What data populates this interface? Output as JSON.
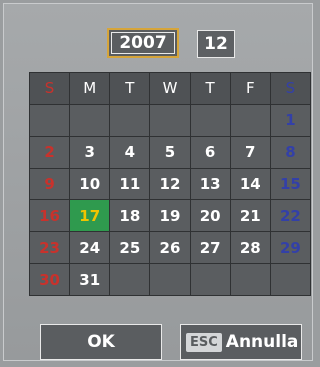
{
  "header": {
    "year": "2007",
    "month": "12"
  },
  "weekdays": [
    "S",
    "M",
    "T",
    "W",
    "T",
    "F",
    "S"
  ],
  "days": [
    [
      "",
      "",
      "",
      "",
      "",
      "",
      "1"
    ],
    [
      "2",
      "3",
      "4",
      "5",
      "6",
      "7",
      "8"
    ],
    [
      "9",
      "10",
      "11",
      "12",
      "13",
      "14",
      "15"
    ],
    [
      "16",
      "17",
      "18",
      "19",
      "20",
      "21",
      "22"
    ],
    [
      "23",
      "24",
      "25",
      "26",
      "27",
      "28",
      "29"
    ],
    [
      "30",
      "31",
      "",
      "",
      "",
      "",
      ""
    ]
  ],
  "selected_day": "17",
  "buttons": {
    "ok_label": "OK",
    "esc_key": "ESC",
    "cancel_label": "Annulla"
  },
  "colors": {
    "sunday": "#c8322c",
    "saturday": "#3340a8",
    "selected_bg": "#2f9a4e",
    "selected_text": "#f0c400",
    "year_focus": "#d6a53a"
  }
}
